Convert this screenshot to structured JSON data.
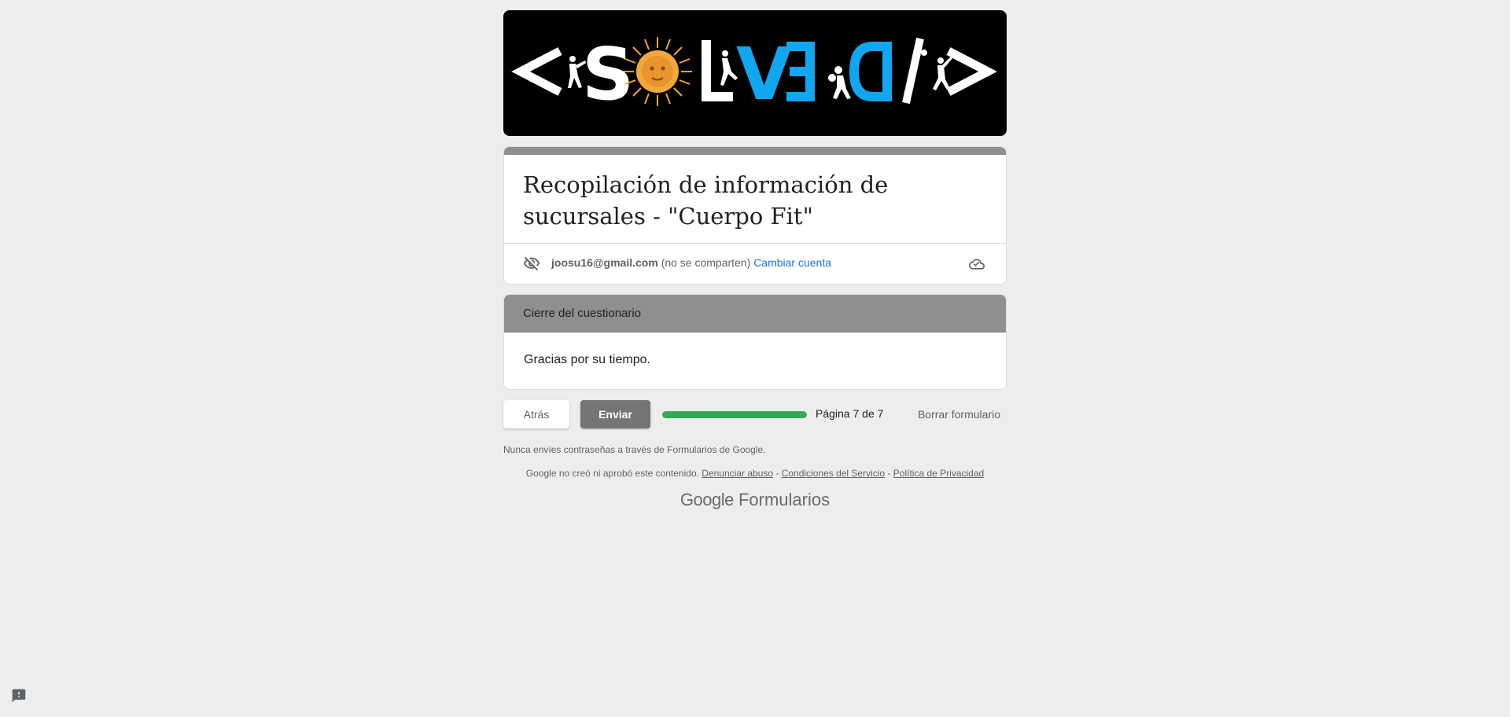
{
  "banner": {
    "letters": [
      "<",
      "S",
      "L",
      "V",
      "E",
      "D",
      "/",
      ">"
    ]
  },
  "form": {
    "title": "Recopilación de información de sucursales - \"Cuerpo Fit\""
  },
  "account": {
    "email": "joosu16@gmail.com",
    "not_shared": "(no se comparten)",
    "switch_label": "Cambiar cuenta"
  },
  "section": {
    "header": "Cierre del cuestionario",
    "body": "Gracias por su tiempo."
  },
  "nav": {
    "back_label": "Atrás",
    "submit_label": "Enviar",
    "progress": 1.0,
    "page_label": "Página 7 de 7",
    "clear_label": "Borrar formulario"
  },
  "footer": {
    "password_notice": "Nunca envíes contraseñas a través de Formularios de Google.",
    "disclaimer_text": "Google no creó ni aprobó este contenido.",
    "report_abuse": "Denunciar abuso",
    "terms": "Condiciones del Servicio",
    "privacy": "Política de Privacidad",
    "separator": " - ",
    "brand_google": "Google",
    "brand_product": "Formularios"
  },
  "colors": {
    "page_bg": "#ededed",
    "accent_gray": "#8f8f8f",
    "progress_green": "#34a853",
    "link_blue": "#1a73e8",
    "banner_blue": "#11a6f0"
  },
  "icons": [
    "visibility-off-icon",
    "cloud-done-icon",
    "report-icon",
    "sun-icon"
  ]
}
